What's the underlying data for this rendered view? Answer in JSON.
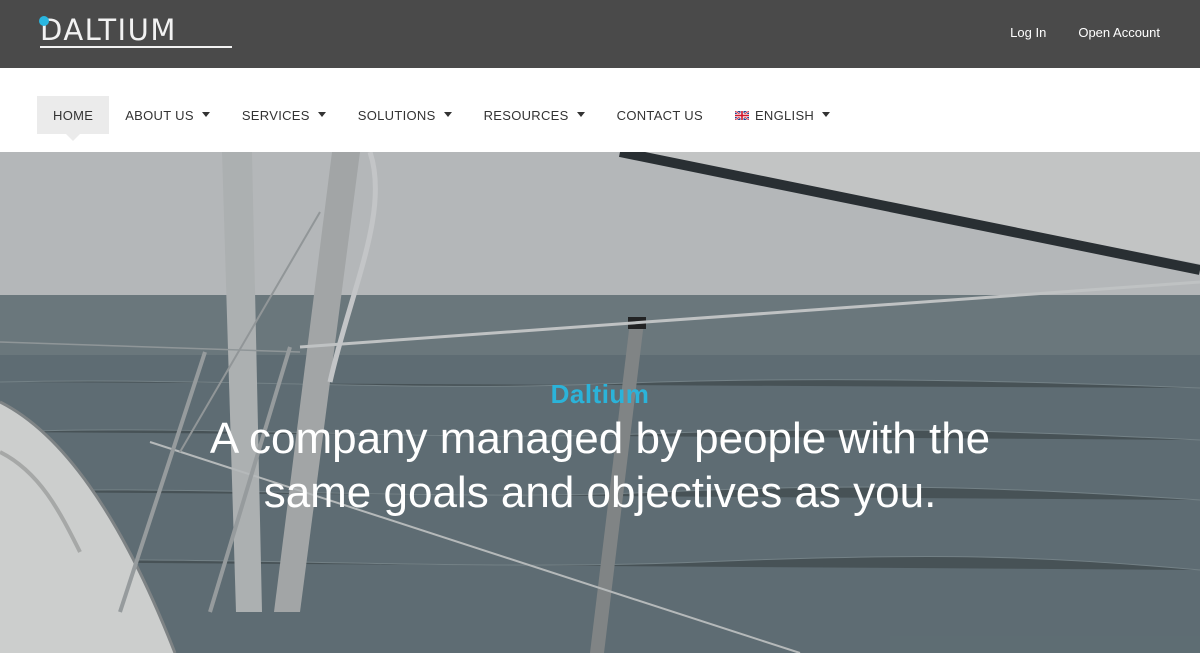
{
  "header": {
    "logo_text": "DALTIUM",
    "links": {
      "login": "Log In",
      "open_account": "Open Account"
    }
  },
  "nav": {
    "home": "HOME",
    "about": "ABOUT US",
    "services": "SERVICES",
    "solutions": "SOLUTIONS",
    "resources": "RESOURCES",
    "contact": "CONTACT US",
    "language": "ENGLISH"
  },
  "hero": {
    "brand": "Daltium",
    "headline": "A company managed by people with the same goals and objectives as you."
  },
  "colors": {
    "topbar_bg": "#4a4a4a",
    "accent": "#2bb3d9",
    "nav_active_bg": "#ebebeb"
  },
  "icons": {
    "language_flag": "uk-flag-icon",
    "dropdown": "caret-down-icon"
  }
}
